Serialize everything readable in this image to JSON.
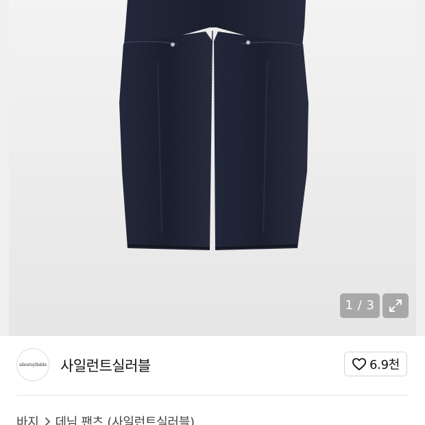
{
  "product_image": {
    "counter_current": "1",
    "counter_separator": "/",
    "counter_total": "3"
  },
  "shop": {
    "logo_text": "silentsyllable",
    "name": "사일런트실러블",
    "likes": "6.9천"
  },
  "breadcrumb": {
    "items": [
      "바지",
      "데님 팬츠 (사일런트실러블)"
    ]
  },
  "colors": {
    "denim": "#1c1f2c",
    "background": "#eeeeee",
    "overlay": "#969696"
  },
  "icons": {
    "expand": "expand-icon",
    "like": "heart-outline-icon",
    "separator": "chevron-right-icon"
  }
}
